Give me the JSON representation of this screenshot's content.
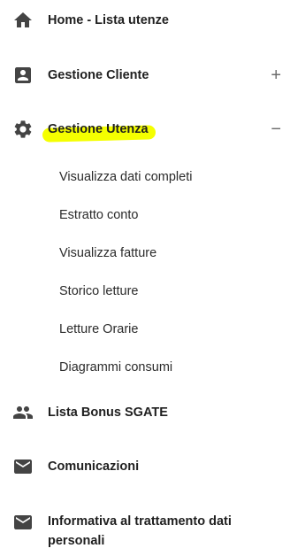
{
  "menu": {
    "home": {
      "label": "Home - Lista utenze",
      "icon": "home-icon"
    },
    "gestione_cliente": {
      "label": "Gestione Cliente",
      "icon": "account-box-icon",
      "toggle": "+"
    },
    "gestione_utenza": {
      "label": "Gestione Utenza",
      "icon": "gear-icon",
      "toggle": "−",
      "highlight_color": "#f5ff00",
      "subitems": [
        "Visualizza dati completi",
        "Estratto conto",
        "Visualizza fatture",
        "Storico letture",
        "Letture Orarie",
        "Diagrammi consumi"
      ]
    },
    "lista_bonus": {
      "label": "Lista Bonus SGATE",
      "icon": "people-icon"
    },
    "comunicazioni": {
      "label": "Comunicazioni",
      "icon": "mail-icon"
    },
    "informativa": {
      "label": "Informativa al trattamento dati personali",
      "icon": "mail-icon"
    }
  }
}
